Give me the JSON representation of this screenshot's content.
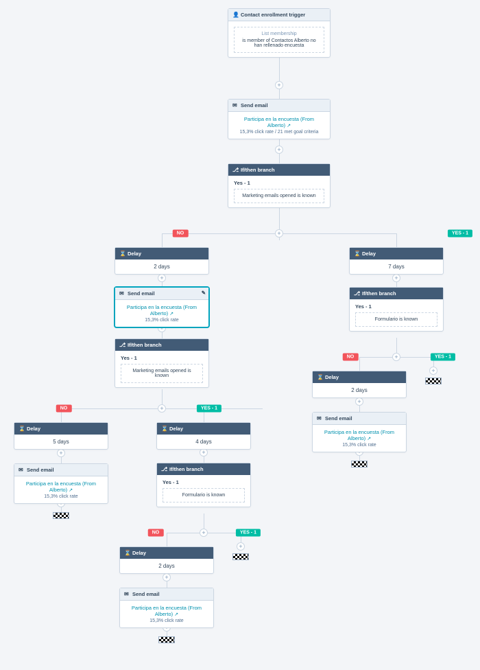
{
  "labels": {
    "no": "NO",
    "yes1": "YES - 1"
  },
  "trigger": {
    "header": "Contact enrollment trigger",
    "inner_title": "List membership",
    "inner_text": "is member of Contactos Alberto no han rellenado encuesta"
  },
  "email1": {
    "header": "Send email",
    "link": "Participa en la encuesta (From Alberto)",
    "stats": "15,3% click rate / 21 met goal criteria"
  },
  "branch1": {
    "header": "If/then branch",
    "yes_label": "Yes - 1",
    "cond_text": "Marketing emails opened is known"
  },
  "delay_no1": {
    "header": "Delay",
    "text": "2 days"
  },
  "email_no1": {
    "header": "Send email",
    "link": "Participa en la encuesta (From Alberto)",
    "stats": "15,3% click rate"
  },
  "branch2": {
    "header": "If/then branch",
    "yes_label": "Yes - 1",
    "cond_text": "Marketing emails opened is known"
  },
  "delay_b2_no": {
    "header": "Delay",
    "text": "5 days"
  },
  "email_b2_no": {
    "header": "Send email",
    "link": "Participa en la encuesta (From Alberto)",
    "stats": "15,3% click rate"
  },
  "delay_b2_yes": {
    "header": "Delay",
    "text": "4 days"
  },
  "branch3": {
    "header": "If/then branch",
    "yes_label": "Yes - 1",
    "cond_text": "Formulario is known"
  },
  "delay_b3_no": {
    "header": "Delay",
    "text": "2 days"
  },
  "email_b3_no": {
    "header": "Send email",
    "link": "Participa en la encuesta (From Alberto)",
    "stats": "15,3% click rate"
  },
  "delay_yes1": {
    "header": "Delay",
    "text": "7 days"
  },
  "branch4": {
    "header": "If/then branch",
    "yes_label": "Yes - 1",
    "cond_text": "Formulario is known"
  },
  "delay_b4_no": {
    "header": "Delay",
    "text": "2 days"
  },
  "email_b4_no": {
    "header": "Send email",
    "link": "Participa en la encuesta (From Alberto)",
    "stats": "15,3% click rate"
  }
}
